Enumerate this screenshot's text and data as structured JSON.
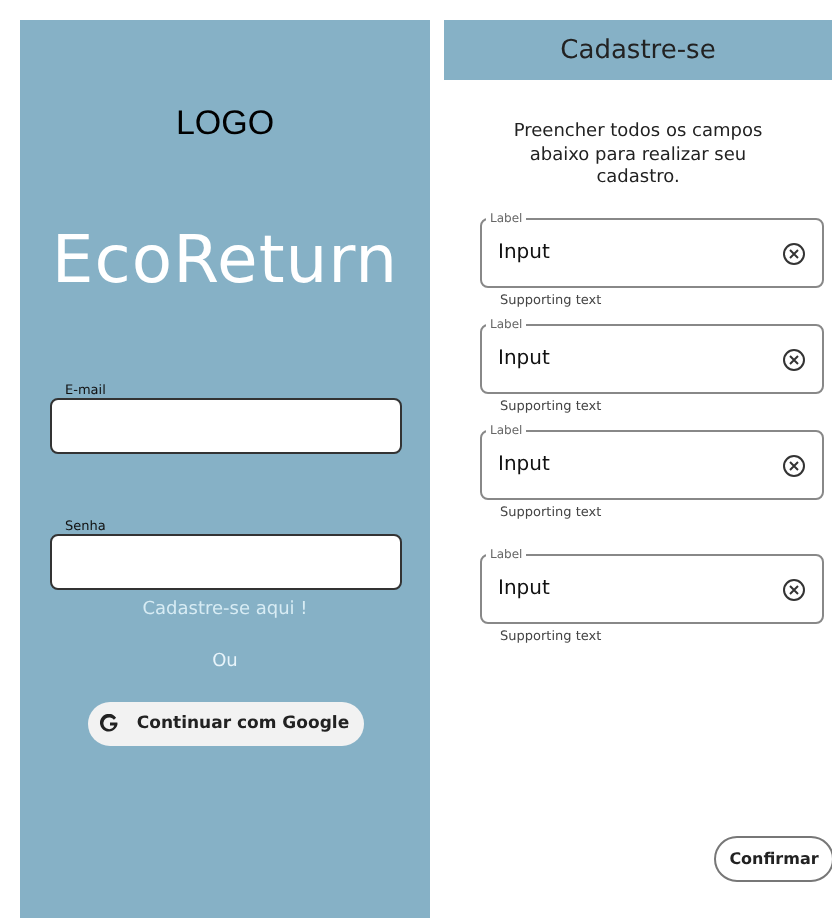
{
  "login": {
    "logo": "LOGO",
    "title": "EcoReturn",
    "fields": [
      {
        "label": "E-mail"
      },
      {
        "label": "Senha"
      }
    ],
    "signup_link": "Cadastre-se aqui !",
    "separator": "Ou",
    "google_button": "Continuar com Google"
  },
  "signup": {
    "title": "Cadastre-se",
    "intro": "Preencher todos os campos abaixo para realizar seu cadastro.",
    "fields": [
      {
        "label": "Label",
        "value": "Input",
        "supporting_text": "Supporting text"
      },
      {
        "label": "Label",
        "value": "Input",
        "supporting_text": "Supporting text"
      },
      {
        "label": "Label",
        "value": "Input",
        "supporting_text": "Supporting text"
      },
      {
        "label": "Label",
        "value": "Input",
        "supporting_text": "Supporting text"
      }
    ],
    "confirm_button": "Confirmar"
  }
}
